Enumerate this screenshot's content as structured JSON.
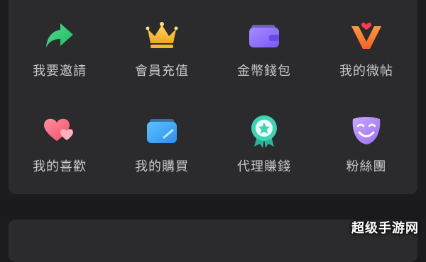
{
  "menu": {
    "items": [
      {
        "label": "我要邀請",
        "icon": "share-arrow-icon"
      },
      {
        "label": "會員充值",
        "icon": "crown-icon"
      },
      {
        "label": "金幣錢包",
        "icon": "wallet-icon"
      },
      {
        "label": "我的微帖",
        "icon": "v-heart-icon"
      },
      {
        "label": "我的喜歡",
        "icon": "hearts-icon"
      },
      {
        "label": "我的購買",
        "icon": "card-icon"
      },
      {
        "label": "代理賺錢",
        "icon": "medal-star-icon"
      },
      {
        "label": "粉絲團",
        "icon": "mask-icon"
      }
    ]
  },
  "watermark": {
    "text": "超级手游网"
  },
  "colors": {
    "background": "#1c1c1e",
    "panel": "#2b2b2e",
    "label": "#c9c9cc"
  }
}
